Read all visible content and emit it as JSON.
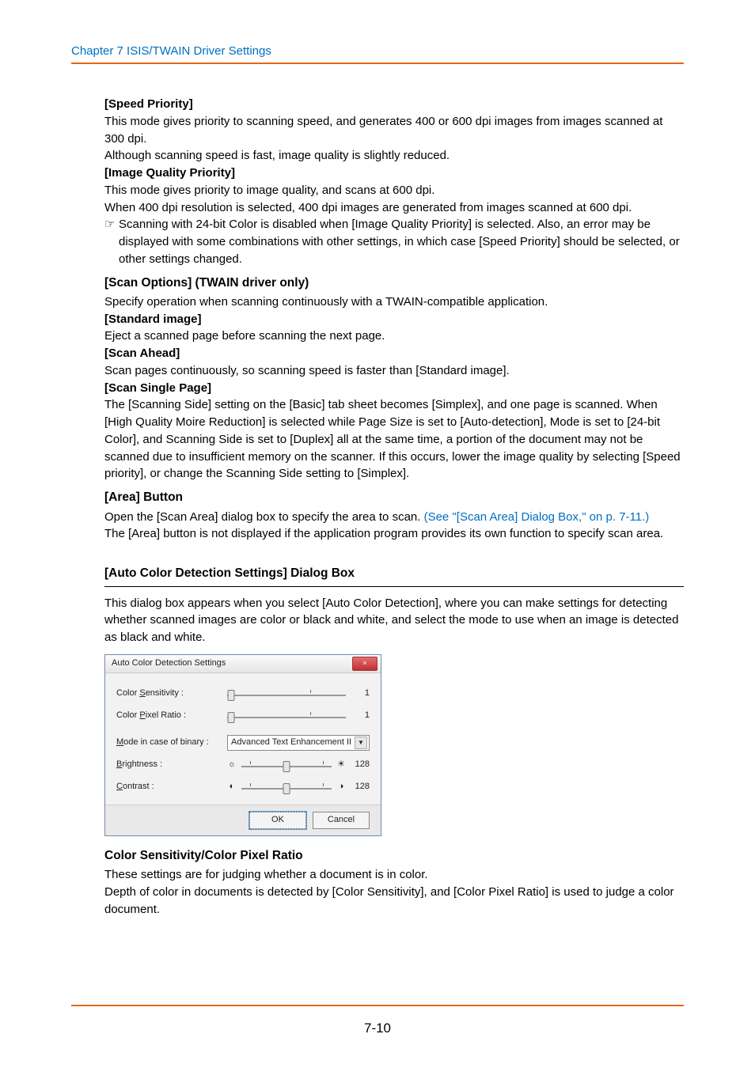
{
  "header": {
    "chapter": "Chapter 7   ISIS/TWAIN Driver Settings"
  },
  "body": {
    "speed_priority": {
      "title": "[Speed Priority]",
      "p1": "This mode gives priority to scanning speed, and generates 400 or 600 dpi images from images scanned at 300 dpi.",
      "p2": "Although scanning speed is fast, image quality is slightly reduced."
    },
    "image_quality_priority": {
      "title": "[Image Quality Priority]",
      "p1": "This mode gives priority to image quality, and scans at 600 dpi.",
      "p2": "When 400 dpi resolution is selected, 400 dpi images are generated from images scanned at 600 dpi.",
      "note_bullet": "☞",
      "note": "Scanning with 24-bit Color is disabled when [Image Quality Priority] is selected. Also, an error may be displayed with some combinations with other settings, in which case [Speed Priority] should be selected, or other settings changed."
    },
    "scan_options": {
      "heading": "[Scan Options] (TWAIN driver only)",
      "intro": "Specify operation when scanning continuously with a TWAIN-compatible application.",
      "standard_title": "[Standard image]",
      "standard_text": "Eject a scanned page before scanning the next page.",
      "ahead_title": "[Scan Ahead]",
      "ahead_text": "Scan pages continuously, so scanning speed is faster than [Standard image].",
      "single_title": "[Scan Single Page]",
      "single_text": "The [Scanning Side] setting on the [Basic] tab sheet becomes [Simplex], and one page is scanned. When [High Quality Moire Reduction] is selected while Page Size is set to [Auto-detection], Mode is set to [24-bit Color], and Scanning Side is set to [Duplex] all at the same time, a portion of the document may not be scanned due to insufficient memory on the scanner. If this occurs, lower the image quality by selecting [Speed priority], or change the Scanning Side setting to [Simplex]."
    },
    "area_button": {
      "heading": "[Area] Button",
      "p1_a": "Open the [Scan Area] dialog box to specify the area to scan. ",
      "p1_link": "(See \"[Scan Area] Dialog Box,\" on p. 7-11.)",
      "p2": "The [Area] button is not displayed if the application program provides its own function to specify scan area."
    },
    "auto_color_section": {
      "title": "[Auto Color Detection Settings] Dialog Box",
      "intro": "This dialog box appears when you select [Auto Color Detection], where you can make settings for detecting whether scanned images are color or black and white, and select the mode to use when an image is detected as black and white."
    },
    "dialog": {
      "title": "Auto Color Detection Settings",
      "close": "×",
      "labels": {
        "color_sensitivity": "Color Sensitivity :",
        "color_pixel_ratio": "Color Pixel Ratio :",
        "mode_binary": "Mode in case of binary :",
        "brightness": "Brightness :",
        "contrast": "Contrast :"
      },
      "values": {
        "color_sensitivity": "1",
        "color_pixel_ratio": "1",
        "mode_binary": "Advanced Text Enhancement II",
        "brightness": "128",
        "contrast": "128"
      },
      "buttons": {
        "ok": "OK",
        "cancel": "Cancel"
      }
    },
    "color_sensitivity": {
      "heading": "Color Sensitivity/Color Pixel Ratio",
      "p1": "These settings are for judging whether a document is in color.",
      "p2": "Depth of color in documents is detected by [Color Sensitivity], and [Color Pixel Ratio] is used to judge a color document."
    }
  },
  "footer": {
    "page_number": "7-10"
  }
}
